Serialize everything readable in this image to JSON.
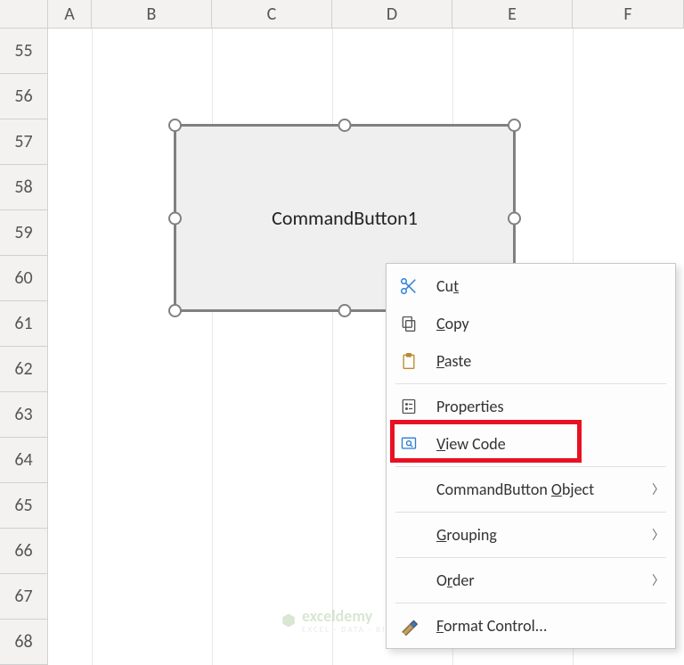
{
  "columns": [
    "A",
    "B",
    "C",
    "D",
    "E",
    "F"
  ],
  "rows": [
    "55",
    "56",
    "57",
    "58",
    "59",
    "60",
    "61",
    "62",
    "63",
    "64",
    "65",
    "66",
    "67",
    "68"
  ],
  "button": {
    "label": "CommandButton1"
  },
  "menu": {
    "cut": "Cut",
    "copy": "Copy",
    "paste": "Paste",
    "properties": "Properties",
    "view_code": "View Code",
    "cb_object": "CommandButton Object",
    "grouping": "Grouping",
    "order": "Order",
    "format_control": "Format Control..."
  },
  "watermark": {
    "brand": "exceldemy",
    "tagline": "EXCEL · DATA · BI"
  }
}
